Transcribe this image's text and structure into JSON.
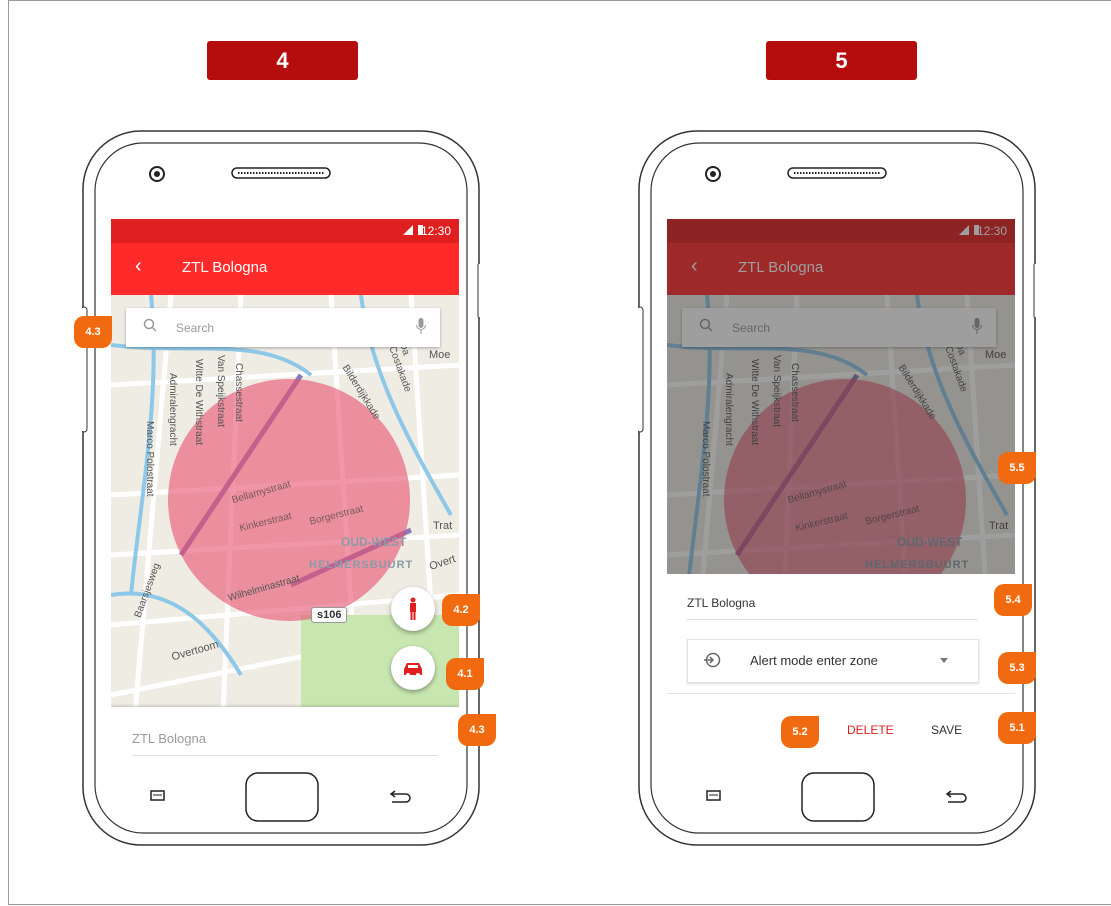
{
  "steps": [
    "4",
    "5"
  ],
  "left_phone": {
    "status_time": "12:30",
    "appbar_title": "ZTL Bologna",
    "back_glyph": "‹",
    "search_placeholder": "Search",
    "bottom_name": "ZTL Bologna",
    "road_shield": "s106",
    "map_labels": [
      "Bellamystraat",
      "Kinkerstraat",
      "Borgerstraat",
      "OUD-WEST",
      "HELMERSBUURT",
      "Wilhelminastraat",
      "Overtoom",
      "Chassestraat",
      "Van Speijkstraat",
      "Witte De Withstraat",
      "Admiralengracht",
      "Marco Polostraat",
      "Bilderdijkkade",
      "Da Costakade",
      "Baarsjesweg",
      "Moe",
      "Trat",
      "Overt"
    ],
    "annotations": {
      "search": "4.3",
      "walk": "4.2",
      "car": "4.1",
      "sheet": "4.3"
    },
    "icons": {
      "search": "search-icon",
      "mic": "mic-icon",
      "walk": "walking-person-icon",
      "car": "car-icon"
    }
  },
  "right_phone": {
    "status_time": "12:30",
    "appbar_title": "ZTL Bologna",
    "back_glyph": "‹",
    "search_placeholder": "Search",
    "name_field": "ZTL Bologna",
    "dropdown_label": "Alert mode enter zone",
    "delete_label": "DELETE",
    "save_label": "SAVE",
    "map_labels": [
      "Bellamystraat",
      "Kinkerstraat",
      "Borgerstraat",
      "OUD-WEST",
      "HELMERSBUURT",
      "Chassestraat",
      "Van Speijkstraat",
      "Witte De Withstraat",
      "Admiralengracht",
      "Marco Polostraat",
      "Bilderdijkkade",
      "Da Costakade",
      "Moe",
      "Trat"
    ],
    "annotations": {
      "circle": "5.5",
      "name": "5.4",
      "dropdown": "5.3",
      "save": "5.1",
      "delete": "5.2"
    }
  },
  "colors": {
    "accent": "#ff2a2a",
    "status": "#e02020",
    "badge": "#f26a0f",
    "zone": "#e8506e",
    "delete": "#e02020"
  }
}
